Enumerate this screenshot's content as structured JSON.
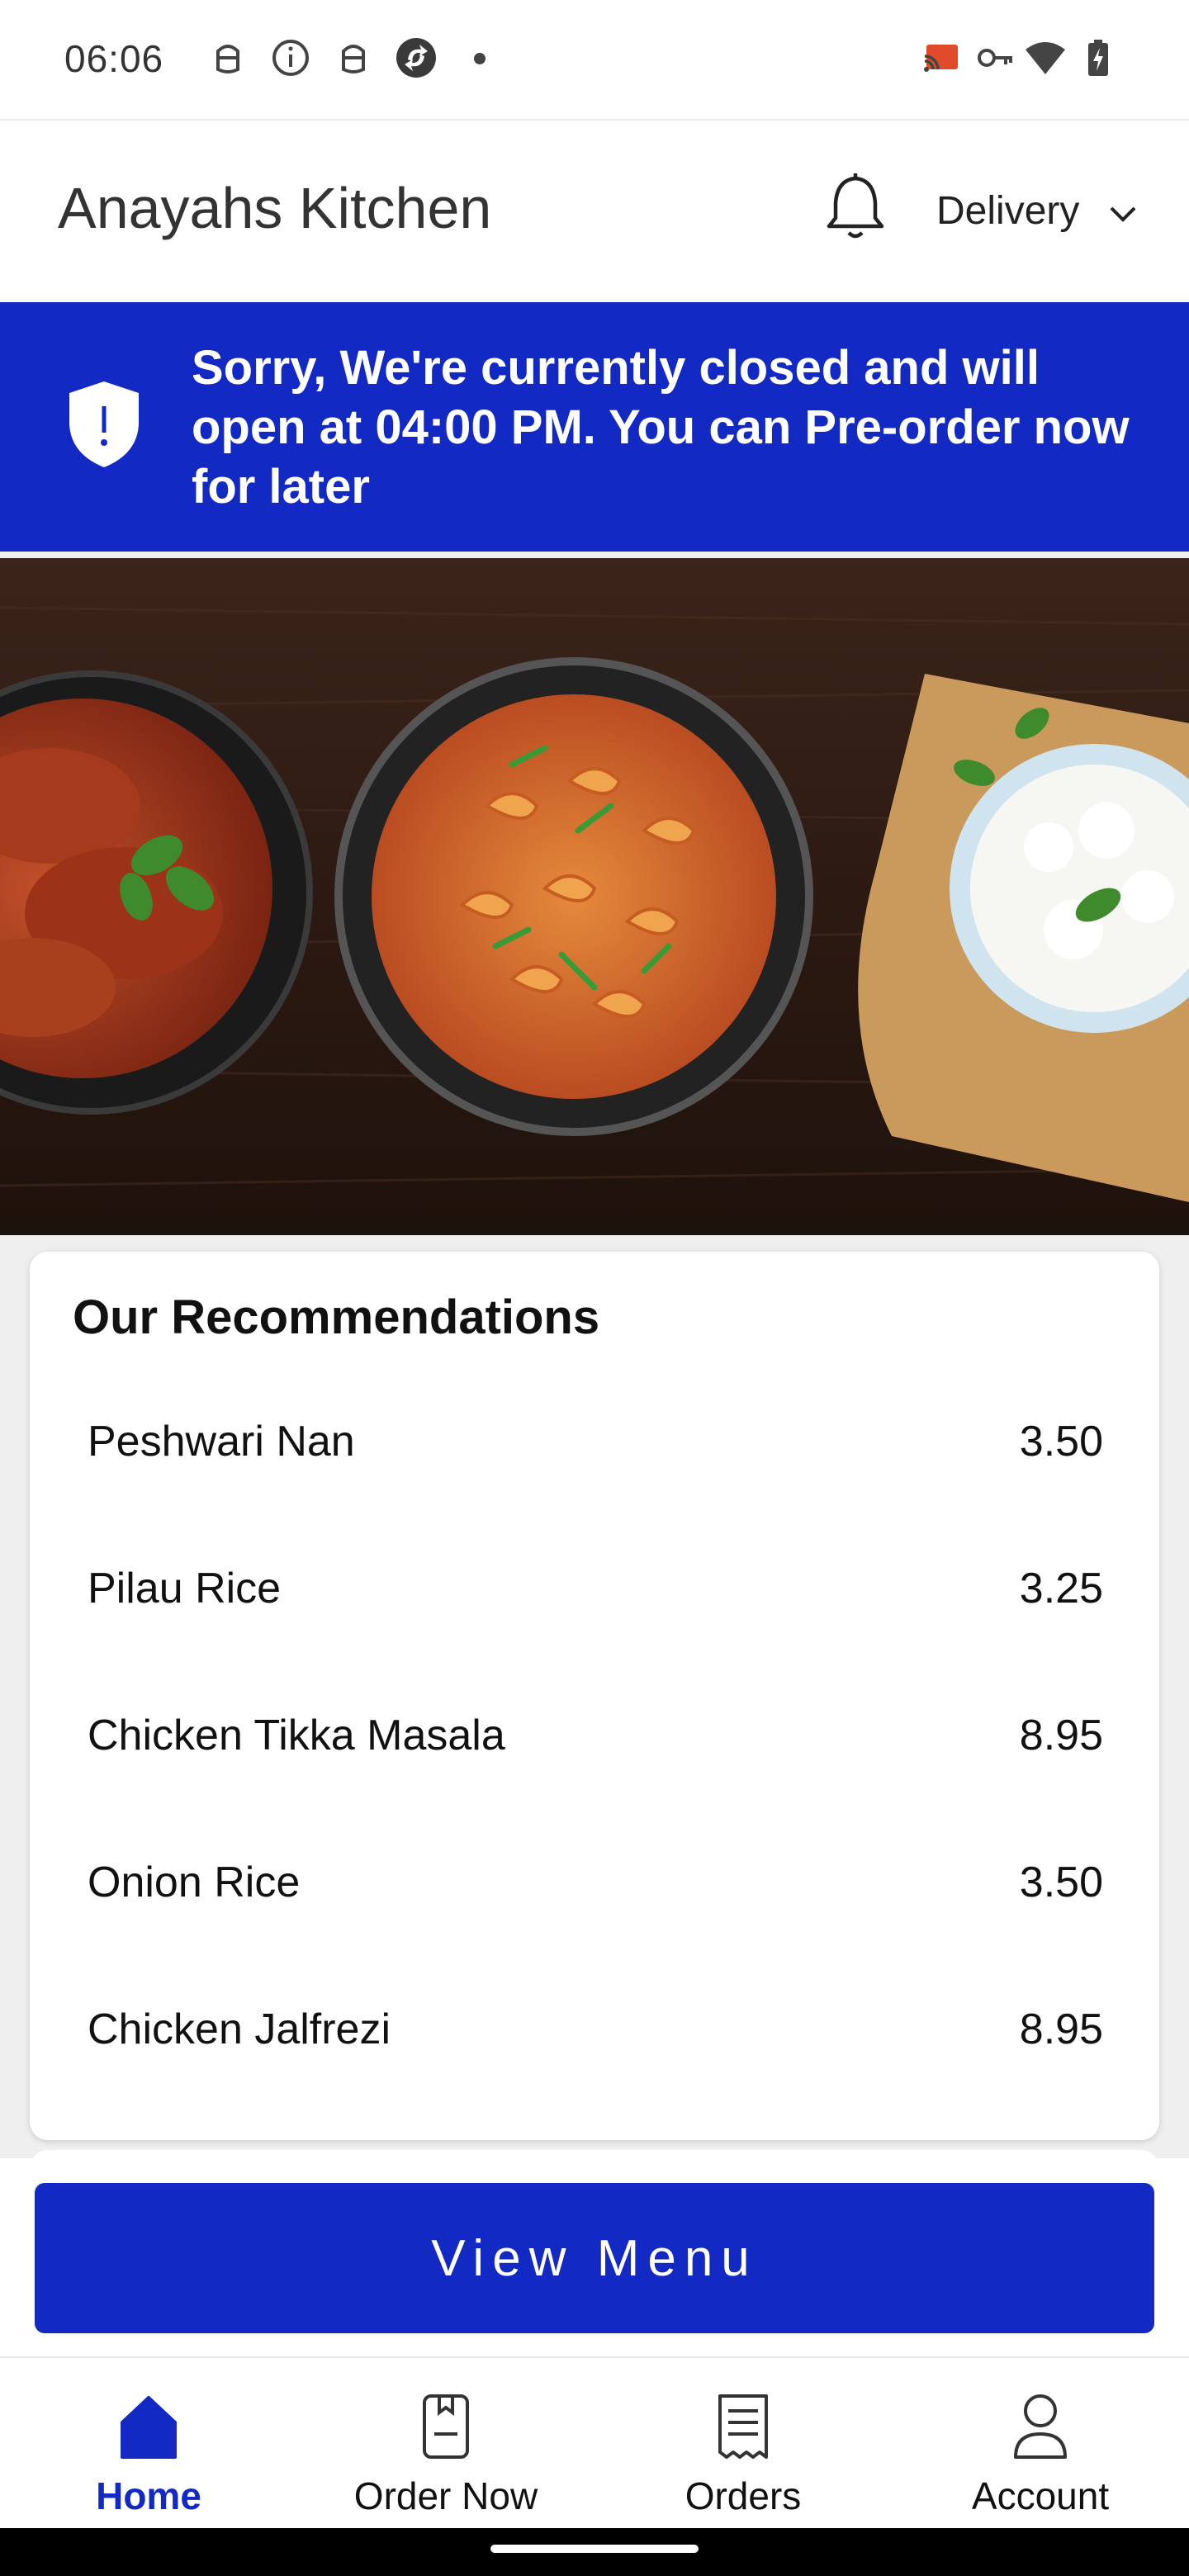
{
  "status_bar": {
    "time": "06:06",
    "left_icons": [
      "android-head-icon",
      "info-icon",
      "android-head-icon",
      "sync-app-icon",
      "notification-dot"
    ],
    "right_icons": [
      "cast-icon",
      "vpn-key-icon",
      "wifi-icon",
      "battery-charging-icon"
    ]
  },
  "header": {
    "title": "Anayahs Kitchen",
    "notification_icon": "bell-icon",
    "order_type": "Delivery",
    "dropdown_icon": "chevron-down-icon"
  },
  "closed_banner": {
    "icon": "shield-alert-icon",
    "message": "Sorry, We're currently closed and will open at 04:00 PM. You can Pre-order now for later",
    "background_color": "#1329c4"
  },
  "hero": {
    "image": "food-dishes-photo"
  },
  "recommendations": {
    "title": "Our Recommendations",
    "items": [
      {
        "name": "Peshwari Nan",
        "price": "3.50"
      },
      {
        "name": "Pilau Rice",
        "price": "3.25"
      },
      {
        "name": "Chicken Tikka Masala",
        "price": "8.95"
      },
      {
        "name": "Onion Rice",
        "price": "3.50"
      },
      {
        "name": "Chicken Jalfrezi",
        "price": "8.95"
      }
    ]
  },
  "view_menu": {
    "label": "View Menu"
  },
  "bottom_nav": {
    "items": [
      {
        "label": "Home",
        "icon": "home-icon",
        "active": true
      },
      {
        "label": "Order Now",
        "icon": "order-book-icon",
        "active": false
      },
      {
        "label": "Orders",
        "icon": "receipt-icon",
        "active": false
      },
      {
        "label": "Account",
        "icon": "user-icon",
        "active": false
      }
    ]
  },
  "colors": {
    "accent": "#1329c4"
  }
}
